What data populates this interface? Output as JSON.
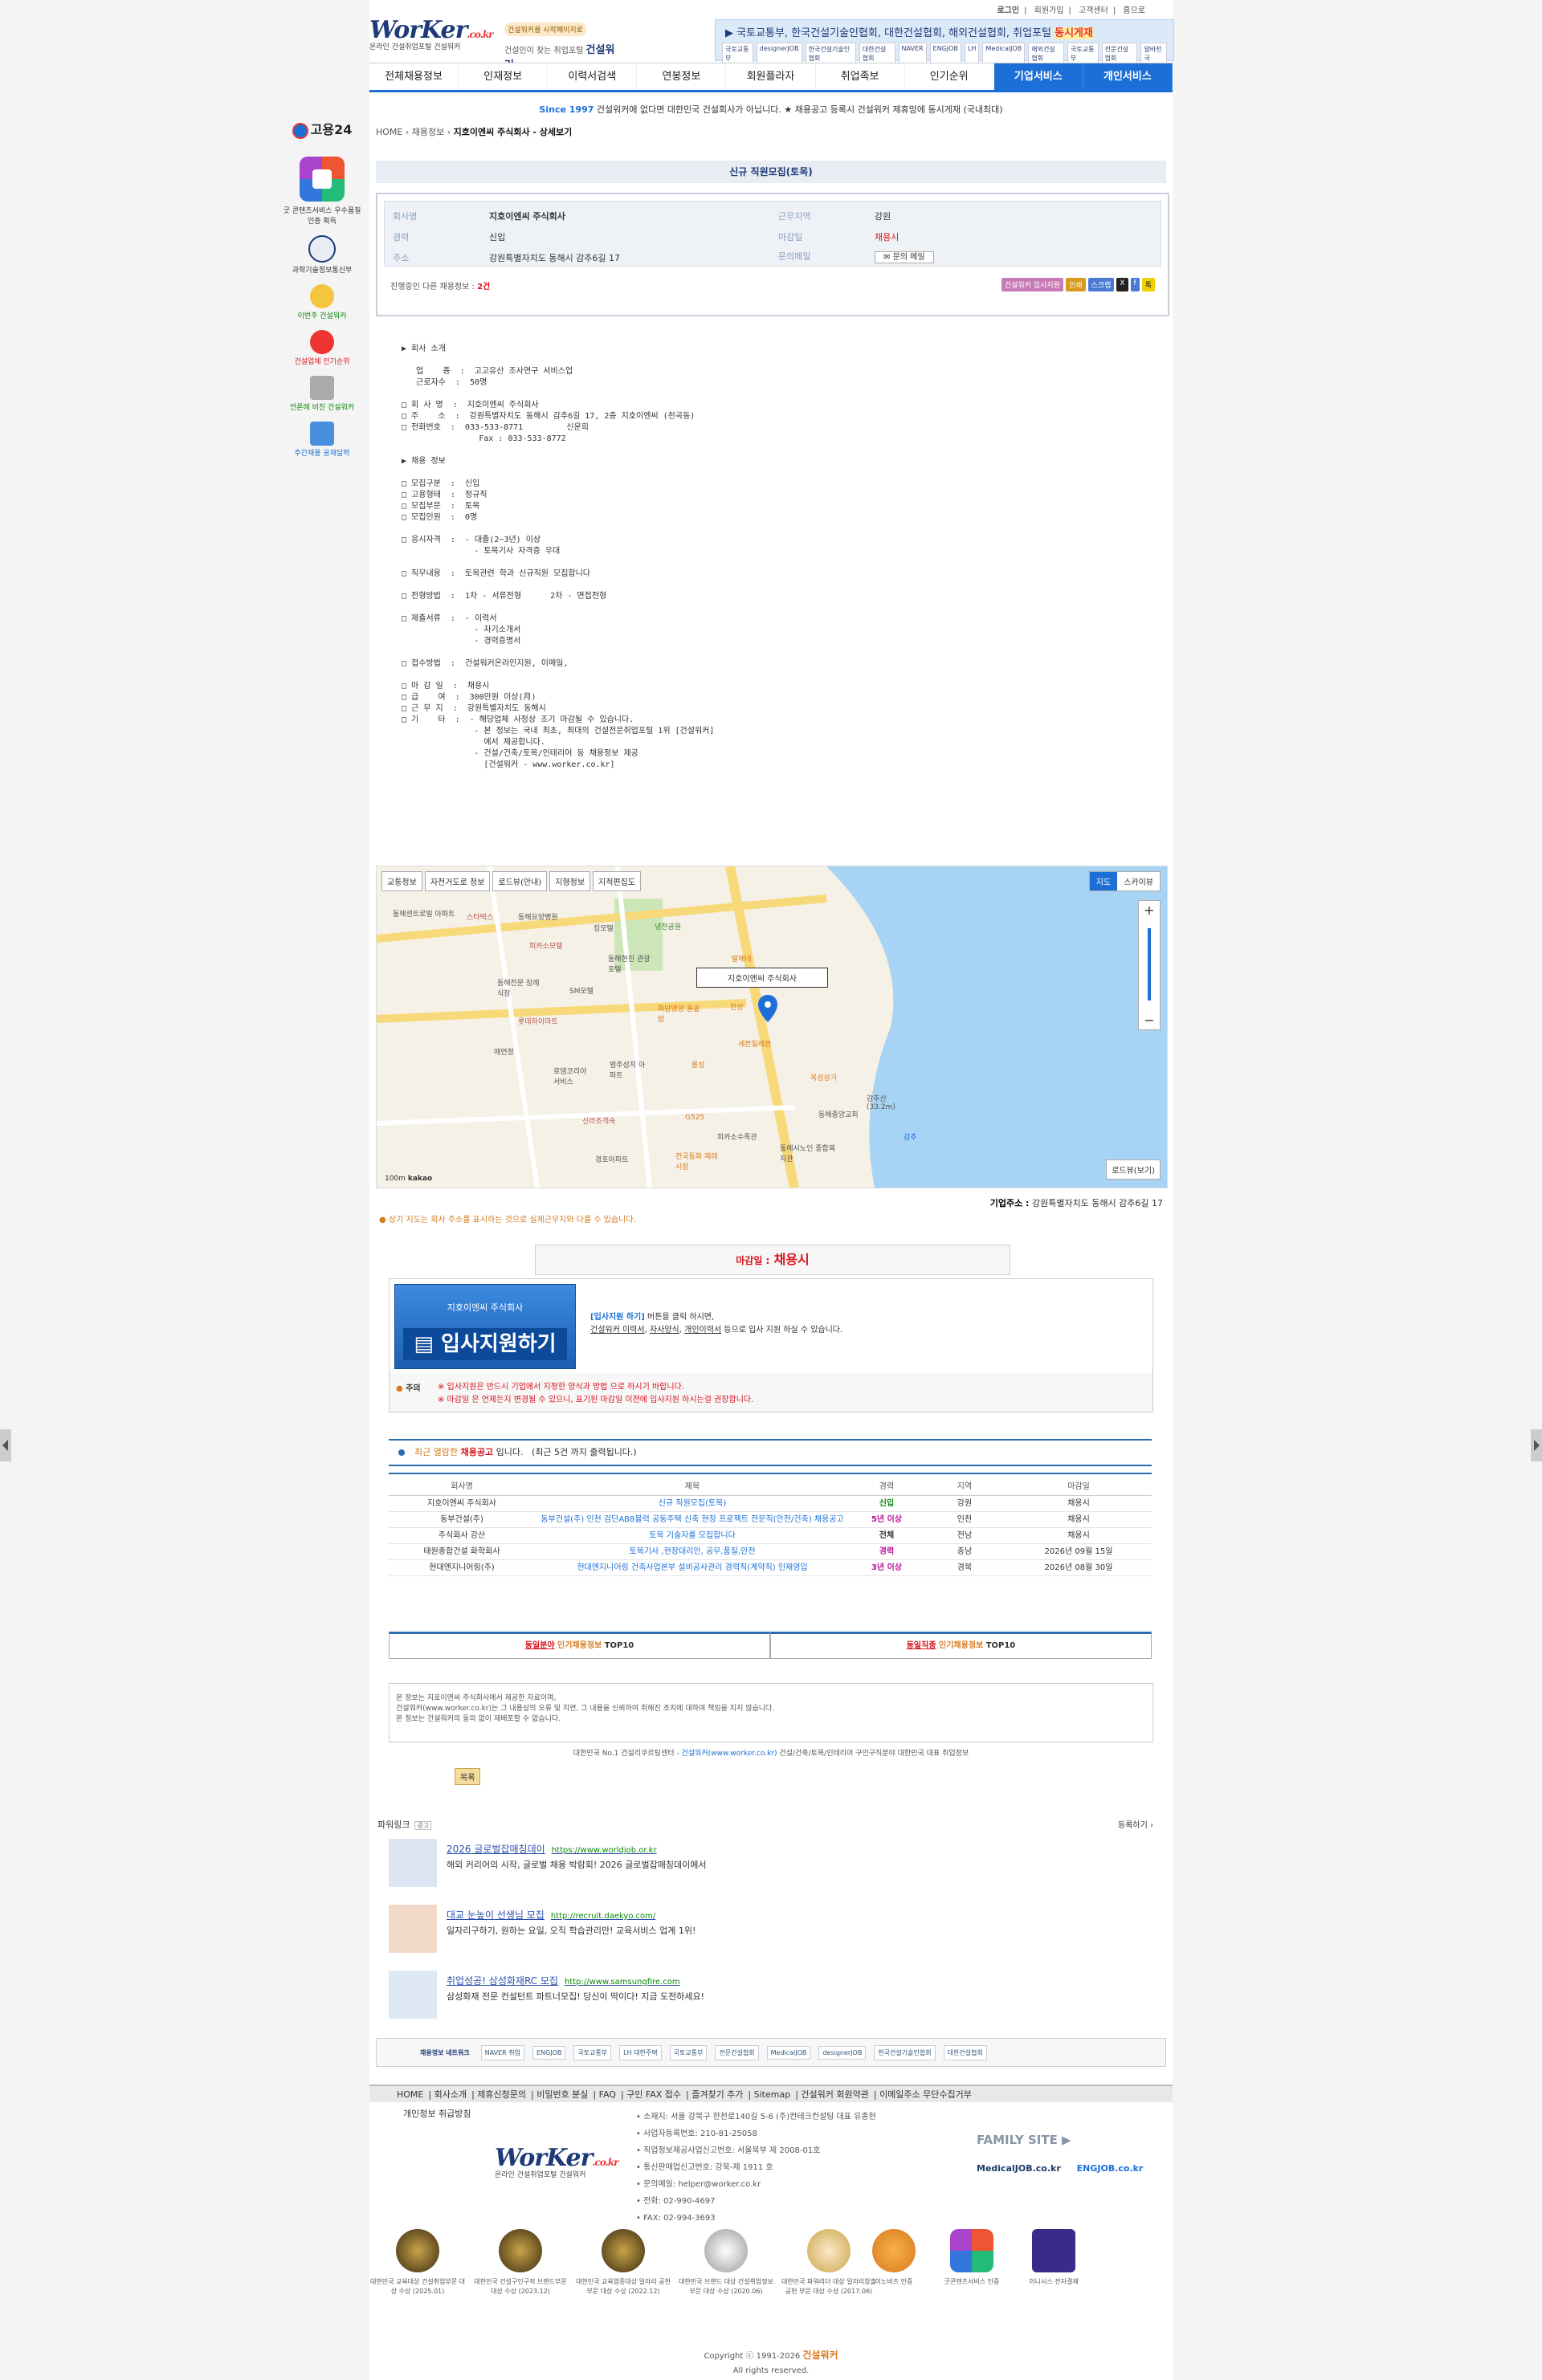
{
  "header": {
    "logo_main": "WorKer",
    "logo_domain": ".co.kr",
    "logo_sub": "온라인 건설취업포털 건설워커",
    "slogan_badge": "건설워커를 시작페이지로",
    "slogan_text_pre": "건설인이 찾는 취업포털",
    "slogan_brand": "건설워커",
    "toplinks": [
      "로그인",
      "회원가입",
      "고객센터",
      "홈으로"
    ],
    "banner_text": "▶ 국토교통부, 한국건설기술인협회, 대한건설협회, 해외건설협회, 취업포털",
    "banner_highlight": "동시게재",
    "banner_logos": [
      "국토교통부",
      "designerJOB",
      "한국건설기술인협회",
      "대한건설협회",
      "NAVER",
      "ENGJOB",
      "LH",
      "MedicalJOB",
      "해외건설협회",
      "국토교통부",
      "전문건설협회",
      "알바천국"
    ]
  },
  "nav": [
    "전체채용정보",
    "인재정보",
    "이력서검색",
    "연봉정보",
    "회원플라자",
    "취업족보",
    "인기순위",
    "기업서비스",
    "개인서비스"
  ],
  "notice": {
    "since": "Since 1997",
    "text": "건설워커에 없다면 대한민국 건설회사가 아닙니다. ★ 채용공고 등록시 건설워커 제휴망에 동시게재 (국내최대)"
  },
  "breadcrumb": {
    "home": "HOME",
    "sep": "›",
    "c1": "채용정보",
    "current": "지호이엔씨 주식회사 - 상세보기"
  },
  "left_float": {
    "g24": "고용24",
    "g_text": "굿 콘텐츠서비스 우수품질인증 획득",
    "ministry": "과학기술정보통신부",
    "items": [
      "이번주 건설워커",
      "건설업체 인기순위",
      "언론에 비친 건설워커",
      "주간채용 공채달력"
    ]
  },
  "job": {
    "title": "신규 직원모집(토목)",
    "labels": {
      "company": "회사명",
      "career": "경력",
      "addr": "주소",
      "region": "근무지역",
      "deadline": "마감일",
      "inquiry": "문의메일"
    },
    "company": "지호이엔씨 주식회사",
    "career": "신입",
    "addr": "강원특별자치도 동해시 감추6길 17",
    "region": "강원",
    "deadline": "채용시",
    "mail_btn": "문의 메일",
    "others_pre": "진행중인 다른 채용정보 :",
    "others_count": "2건",
    "actions": [
      "건설워커 입사지원",
      "인쇄",
      "스크랩",
      "X",
      "f",
      "톡"
    ]
  },
  "description": "▶ 회사 소개\n\n   업    종  :  고고유산 조사연구 서비스업\n   근로자수  :  50명\n\n□ 회 사 명  :  지호이엔씨 주식회사\n□ 주    소  :  강원특별자치도 동해시 감추6길 17, 2층 지호이엔씨 (천곡동)\n□ 전화번호  :  033-533-8771         신운희\n                Fax : 033-533-8772\n\n▶ 채용 정보\n\n□ 모집구분  :  신입\n□ 고용형태  :  정규직\n□ 모집부문  :  토목\n□ 모집인원  :  0명\n\n□ 응시자격  :  - 대졸(2~3년) 이상\n               - 토목기사 자격증 우대\n\n□ 직무내용  :  토목관련 학과 신규직원 모집합니다\n\n□ 전형방법  :  1차 - 서류전형      2차 - 면접전형\n\n□ 제출서류  :  - 이력서\n               - 자기소개서\n               - 경력증명서\n\n□ 접수방법  :  건설워커온라인지원, 이메일,\n\n□ 마 감 일  :  채용시\n□ 급    여  :  300만원 이상(月)\n□ 근 무 지  :  강원특별자치도 동해시\n□ 기    타  :  - 해당업체 사정상 조기 마감될 수 있습니다.\n               - 본 정보는 국내 최초, 최대의 건설전문취업포털 1위 [건설워커]\n                 에서 제공합니다.\n               - 건설/건축/토목/인테리어 등 채용정보 제공\n                 [건설워커 - www.worker.co.kr]",
  "map": {
    "tools": [
      "교통정보",
      "자전거도로 정보",
      "로드뷰(안내)",
      "지형정보",
      "지적편집도"
    ],
    "types": [
      "지도",
      "스카이뷰"
    ],
    "marker_label": "지호이엔씨 주식회사",
    "roadview": "로드뷰(보기)",
    "scale": "100m",
    "brand": "kakao",
    "places": [
      "동해센트로빌 아파트",
      "스타벅스",
      "동해요양병원",
      "킹모텔",
      "냉천공원",
      "피카소모텔",
      "동해현진 관광호텔",
      "발해네",
      "동해전문 장례식장",
      "SM모텔",
      "한성",
      "화담명양 돌솥밥",
      "롯데하이마트",
      "애연정",
      "세븐일레븐",
      "로뎀코리아 서비스",
      "범주성지 아파트",
      "용성",
      "옥성상가",
      "신라조객숙",
      "G525",
      "감추산 (33.2m)",
      "피카소수족관",
      "동해시노인 종합복지관",
      "경포아파트",
      "전국동화 재래시장",
      "동해중앙교회",
      "감추"
    ],
    "addr_label": "기업주소 :",
    "addr": "강원특별자치도 동해시 감추6길 17",
    "note": "상기 지도는 회사 주소를 표시하는 것으로 실제근무지와 다를 수 있습니다."
  },
  "apply": {
    "deadline_label": "마감일 :",
    "deadline": "채용시",
    "company": "지호이엔씨 주식회사",
    "button": "입사지원하기",
    "txt1_b": "[입사지원 하기]",
    "txt1": " 버튼을 클릭 하시면,",
    "txt2_a": "건설워커 이력서",
    "txt2_b": "자사양식",
    "txt2_c": "개인이력서",
    "txt2_d": " 등으로 입사 지원 하실 수 있습니다.",
    "warn_label": "주의",
    "warn1": "※ 입사지원은 반드시 기업에서 지정한 양식과 방법 으로 하시기 바랍니다.",
    "warn2": "※ 마감일 은 언제든지 변경될 수 있으니, 표기된 마감일 이전에 입사지원 하시는걸 권장합니다."
  },
  "recent": {
    "h_pre": "최근 열람한",
    "h_b": "채용공고",
    "h_post": "입니다.",
    "h_note": "(최근 5건 까지 출력됩니다.)",
    "columns": [
      "회사명",
      "제목",
      "경력",
      "지역",
      "마감일"
    ],
    "rows": [
      {
        "company": "지호이엔씨 주식회사",
        "title": "신규 직원모집(토목)",
        "career": "신입",
        "region": "강원",
        "deadline": "채용시"
      },
      {
        "company": "동부건설(주)",
        "title": "동부건설(주) 인천 검단AB8블럭 공동주택 신축 현장 프로젝트 전문직(안전/건축) 채용공고",
        "career": "5년 이상",
        "region": "인천",
        "deadline": "채용시"
      },
      {
        "company": "주식회사 강산",
        "title": "토목 기술자를 모집합니다",
        "career": "전체",
        "region": "전남",
        "deadline": "채용시"
      },
      {
        "company": "태원종합건설 화학회사",
        "title": "토목기사 ,현장대리인, 공무,품질,안전",
        "career": "경력",
        "region": "충남",
        "deadline": "2026년 09월 15일"
      },
      {
        "company": "현대엔지니어링(주)",
        "title": "현대엔지니어링 건축사업본부 설비공사관리 경력직(계약직) 인재영입",
        "career": "3년 이상",
        "region": "경북",
        "deadline": "2026년 08월 30일"
      }
    ]
  },
  "top10": {
    "a_r": "동일분야",
    "a_o": " 인기채용정보",
    "a_t": " TOP10",
    "b_r": "동일직종",
    "b_o": " 인기채용정보",
    "b_t": " TOP10"
  },
  "disclaimer": [
    "본 정보는 지호이엔씨 주식회사에서 제공한 자료이며,",
    "건설워커(www.worker.co.kr)는 그 내용상의 오류 및 지연, 그 내용을 신뢰하여 취해진 조치에 대하여 책임을 지지 않습니다.",
    "본 정보는 건설워커의 동의 없이 재배포할 수 없습니다."
  ],
  "kline": {
    "pre": "대한민국 No.1 건설리쿠르팅센터 -",
    "b": "건설워커(www.worker.co.kr)",
    "post": "건설/건축/토목/인테리어 구인구직분야 대한민국 대표 취업정보"
  },
  "list_btn": "목록",
  "powerlink": {
    "head": "파워링크",
    "ad_tag": "광고",
    "register": "등록하기 ›",
    "ads": [
      {
        "title": "2026 글로벌잡매칭데이",
        "url": "https://www.worldjob.or.kr",
        "text": "해외 커리어의 시작, 글로벌 채용 박람회! 2026 글로벌잡매칭데이에서"
      },
      {
        "title": "대교 눈높이 선생님 모집",
        "url": "http://recruit.daekyo.com/",
        "text": "일자리구하기, 원하는 요일, 오직 학습관리만! 교육서비스 업계 1위!"
      },
      {
        "title": "취업성공! 삼성화재RC 모집",
        "url": "http://www.samsungfire.com",
        "text": "삼성화재 전문 컨설턴트 파트너모집! 당신이 딱이다! 지금 도전하세요!"
      }
    ]
  },
  "partners": [
    "채용정보 네트워크",
    "NAVER 취업",
    "ENGJOB",
    "국토교통부",
    "LH 대한주택",
    "국토교통부",
    "전문건설협회",
    "MedicalJOB",
    "designerJOB",
    "한국건설기술인협회",
    "대한건설협회"
  ],
  "footer": {
    "nav": [
      "HOME",
      "회사소개",
      "제휴신청문의",
      "비밀번호 분실",
      "FAQ",
      "구인 FAX 접수",
      "즐겨찾기 추가",
      "Sitemap",
      "건설워커 회원약관",
      "이메일주소 무단수집거부"
    ],
    "privacy": "개인정보 취급방침",
    "info": [
      "• 소재지: 서울 강북구 한천로140길 5-6 (주)컨테크컨설팅 대표 유종현",
      "• 사업자등록번호: 210-81-25058",
      "• 직업정보제공사업신고번호: 서울북부 제 2008-01호",
      "• 통신판매업신고번호: 강북-제 1911 호",
      "• 문의메일: helper@worker.co.kr",
      "• 전화: 02-990-4697",
      "• FAX: 02-994-3693"
    ],
    "family": "FAMILY SITE ▶",
    "family_sites": [
      "MedicalJOB.co.kr",
      "ENGJOB.co.kr"
    ],
    "awards": [
      "대한민국 교육대상 건설취업부문 대상 수상 (2025.01)",
      "대한민국 건설구인구직 브랜드부문 대상 수상 (2023.12)",
      "대한민국 교육업종대상 일자리 공헌부문 대상 수상 (2022.12)",
      "대한민국 브랜드 대상 건설취업정보 부문 대상 수상 (2020.06)",
      "대한민국 파워리더 대상 일자리창출공헌 부문 대상 수상 (2017.06)",
      "이노비즈 인증",
      "굿콘텐츠서비스 인증",
      "이니시스 전자결제"
    ],
    "copyright": "Copyright ⓒ 1991-2026",
    "copyright_brand": "건설워커",
    "rights": "All rights reserved."
  }
}
